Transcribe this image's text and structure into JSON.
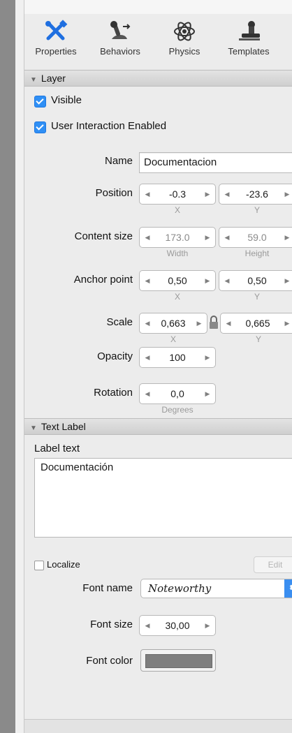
{
  "toolbar": {
    "tabs": [
      {
        "label": "Properties",
        "icon": "tools-icon"
      },
      {
        "label": "Behaviors",
        "icon": "joystick-icon"
      },
      {
        "label": "Physics",
        "icon": "atom-icon"
      },
      {
        "label": "Templates",
        "icon": "stamp-icon"
      }
    ]
  },
  "layer": {
    "header": "Layer",
    "visible_label": "Visible",
    "user_interaction_label": "User Interaction Enabled",
    "name_label": "Name",
    "name_value": "Documentacion",
    "position_label": "Position",
    "position_x": "-0.3",
    "position_y": "-23.6",
    "position_x_sub": "X",
    "position_y_sub": "Y",
    "content_size_label": "Content size",
    "content_w": "173.0",
    "content_h": "59.0",
    "content_w_sub": "Width",
    "content_h_sub": "Height",
    "anchor_label": "Anchor point",
    "anchor_x": "0,50",
    "anchor_y": "0,50",
    "anchor_x_sub": "X",
    "anchor_y_sub": "Y",
    "scale_label": "Scale",
    "scale_x": "0,663",
    "scale_y": "0,665",
    "scale_x_sub": "X",
    "scale_y_sub": "Y",
    "opacity_label": "Opacity",
    "opacity_value": "100",
    "rotation_label": "Rotation",
    "rotation_value": "0,0",
    "rotation_sub": "Degrees"
  },
  "text_label": {
    "header": "Text Label",
    "label_text_caption": "Label text",
    "label_text_value": "Documentación",
    "localize_label": "Localize",
    "edit_label": "Edit",
    "font_name_label": "Font name",
    "font_name_value": "Noteworthy",
    "font_size_label": "Font size",
    "font_size_value": "30,00",
    "font_color_label": "Font color",
    "font_color_hex": "#7e7e7e"
  },
  "colors": {
    "accent": "#2f8ff5"
  }
}
